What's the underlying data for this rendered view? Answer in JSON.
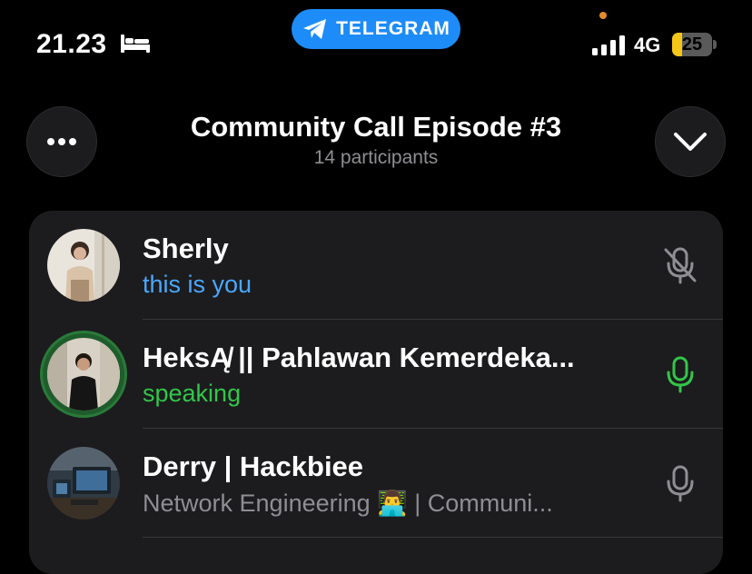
{
  "status_bar": {
    "time": "21.23",
    "pill_label": "TELEGRAM",
    "network": "4G",
    "battery_level": "25",
    "battery_fraction": 0.25
  },
  "header": {
    "title": "Community Call Episode #3",
    "subtitle": "14 participants"
  },
  "participants": [
    {
      "name": "Sherly",
      "status": "this is you",
      "mic": "mic-muted-icon"
    },
    {
      "name": "HeksĄ̸ || Pahlawan Kemerdeka...",
      "status": "speaking",
      "mic": "mic-active-icon"
    },
    {
      "name": "Derry | Hackbiee",
      "status": "Network Engineering 👨‍💻 | Communi...",
      "mic": "mic-icon"
    }
  ],
  "colors": {
    "accent_blue": "#1d8cf8",
    "you_blue": "#4aa8ff",
    "speaking_green": "#33c54a",
    "muted_gray": "#8e8e93",
    "card_bg": "#1c1c1e"
  }
}
